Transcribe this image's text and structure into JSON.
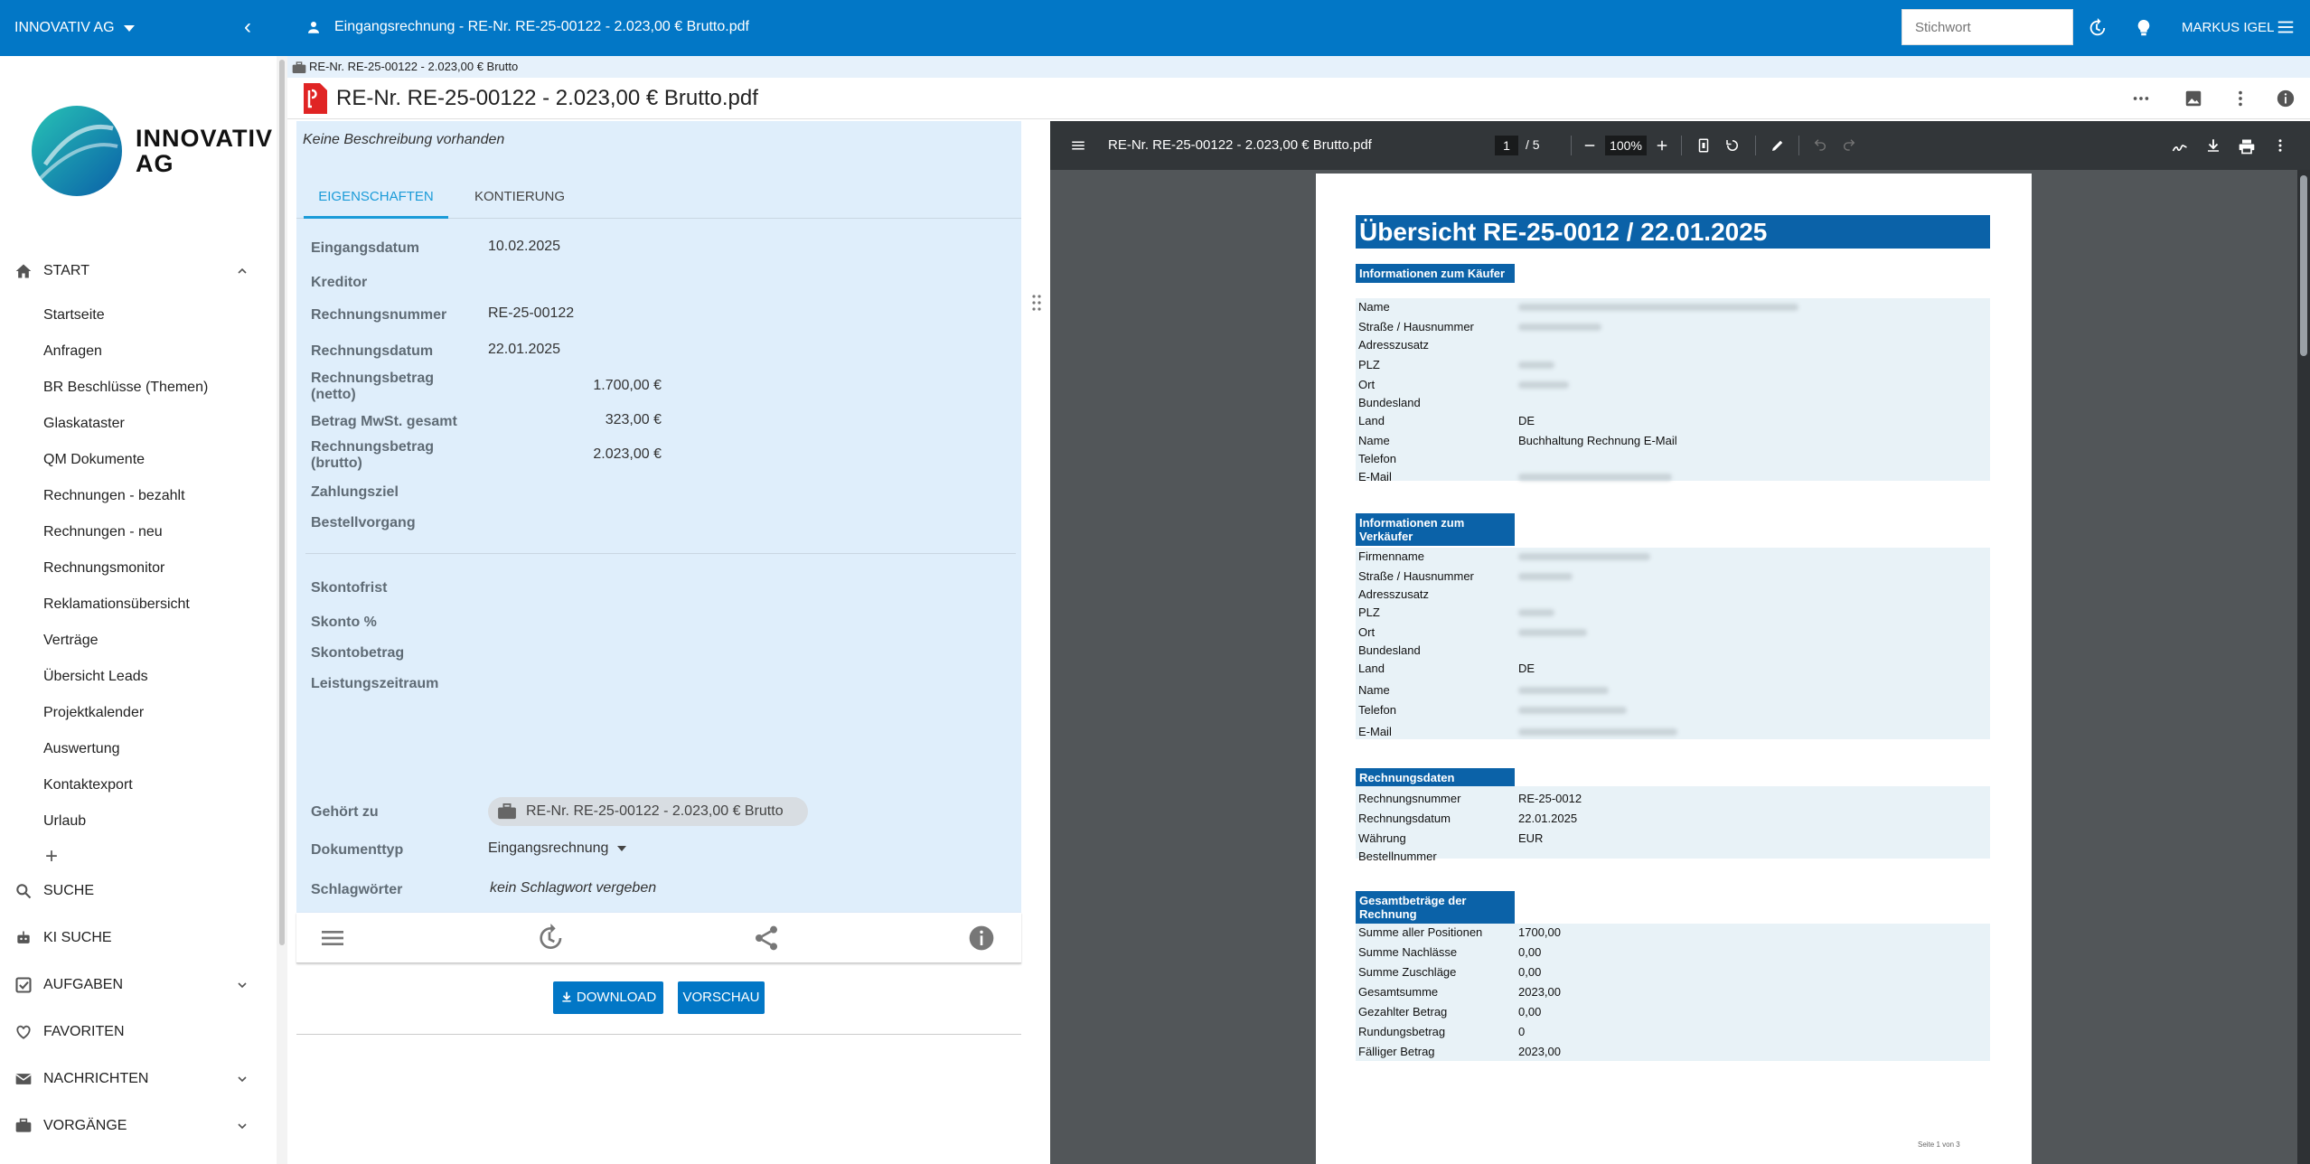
{
  "topbar": {
    "company": "INNOVATIV AG",
    "breadcrumb": "Eingangsrechnung - RE-Nr. RE-25-00122 - 2.023,00 € Brutto.pdf",
    "search_placeholder": "Stichwort",
    "user": "MARKUS IGEL"
  },
  "logo": {
    "line1": "INNOVATIV",
    "line2": "AG"
  },
  "sidebar": {
    "start_label": "START",
    "items": [
      "Startseite",
      "Anfragen",
      "BR Beschlüsse (Themen)",
      "Glaskataster",
      "QM Dokumente",
      "Rechnungen - bezahlt",
      "Rechnungen - neu",
      "Rechnungsmonitor",
      "Reklamationsübersicht",
      "Verträge",
      "Übersicht Leads",
      "Projektkalender",
      "Auswertung",
      "Kontaktexport",
      "Urlaub"
    ],
    "add": "+",
    "suche": "SUCHE",
    "ki_suche": "KI SUCHE",
    "aufgaben": "AUFGABEN",
    "favoriten": "FAVORITEN",
    "nachrichten": "NACHRICHTEN",
    "vorgaenge": "VORGÄNGE"
  },
  "doc": {
    "header": "RE-Nr. RE-25-00122 - 2.023,00 € Brutto",
    "title": "RE-Nr. RE-25-00122 - 2.023,00 € Brutto.pdf",
    "description": "Keine Beschreibung vorhanden"
  },
  "tabs": {
    "eigenschaften": "EIGENSCHAFTEN",
    "kontierung": "KONTIERUNG"
  },
  "props": {
    "eingangsdatum_l": "Eingangsdatum",
    "eingangsdatum_v": "10.02.2025",
    "kreditor_l": "Kreditor",
    "rechnungsnummer_l": "Rechnungsnummer",
    "rechnungsnummer_v": "RE-25-00122",
    "rechnungsdatum_l": "Rechnungsdatum",
    "rechnungsdatum_v": "22.01.2025",
    "netto_l1": "Rechnungsbetrag",
    "netto_l2": "(netto)",
    "netto_v": "1.700,00 €",
    "mwst_l": "Betrag MwSt. gesamt",
    "mwst_v": "323,00 €",
    "brutto_l1": "Rechnungsbetrag",
    "brutto_l2": "(brutto)",
    "brutto_v": "2.023,00 €",
    "zahlungsziel_l": "Zahlungsziel",
    "bestellvorgang_l": "Bestellvorgang",
    "skontofrist_l": "Skontofrist",
    "skonto_l": "Skonto %",
    "skontobetrag_l": "Skontobetrag",
    "leistungszeitraum_l": "Leistungszeitraum",
    "gehoert_l": "Gehört zu",
    "gehoert_v": "RE-Nr. RE-25-00122 - 2.023,00 € Brutto",
    "dokumenttyp_l": "Dokumenttyp",
    "dokumenttyp_v": "Eingangsrechnung",
    "schlagwoerter_l": "Schlagwörter",
    "schlagwoerter_v": "kein Schlagwort vergeben"
  },
  "buttons": {
    "download": "DOWNLOAD",
    "vorschau": "VORSCHAU"
  },
  "viewer": {
    "filename": "RE-Nr. RE-25-00122 - 2.023,00 € Brutto.pdf",
    "page": "1",
    "pages": "/  5",
    "zoom": "100%"
  },
  "pdf": {
    "title": "Übersicht RE-25-0012 / 22.01.2025",
    "kaeufer_h": "Informationen zum Käufer",
    "kaeufer_rows": [
      "Name",
      "Straße / Hausnummer",
      "Adresszusatz",
      "PLZ",
      "Ort",
      "Bundesland",
      "Land",
      "Name",
      "Telefon",
      "E-Mail"
    ],
    "kaeufer_land": "DE",
    "kaeufer_name2": "Buchhaltung Rechnung E-Mail",
    "verkaeufer_h": "Informationen zum Verkäufer",
    "verkaeufer_rows": [
      "Firmenname",
      "Straße / Hausnummer",
      "Adresszusatz",
      "PLZ",
      "Ort",
      "Bundesland",
      "Land",
      "Name",
      "Telefon",
      "E-Mail"
    ],
    "verkaeufer_land": "DE",
    "rdaten_h": "Rechnungsdaten",
    "rdaten_rows": [
      "Rechnungsnummer",
      "Rechnungsdatum",
      "Währung",
      "Bestellnummer"
    ],
    "rdaten_vals": [
      "RE-25-0012",
      "22.01.2025",
      "EUR",
      ""
    ],
    "ges_h": "Gesamtbeträge der Rechnung",
    "ges_rows": [
      "Summe aller Positionen",
      "Summe Nachlässe",
      "Summe Zuschläge",
      "Gesamtsumme",
      "Gezahlter Betrag",
      "Rundungsbetrag",
      "Fälliger Betrag"
    ],
    "ges_vals": [
      "1700,00",
      "0,00",
      "0,00",
      "2023,00",
      "0,00",
      "0",
      "2023,00"
    ],
    "footer": "Seite 1 von 3"
  },
  "colors": {
    "primary": "#0277c6",
    "panel": "#dfeefb",
    "pdf_header": "#0b62a8",
    "viewer_bg": "#525659"
  }
}
